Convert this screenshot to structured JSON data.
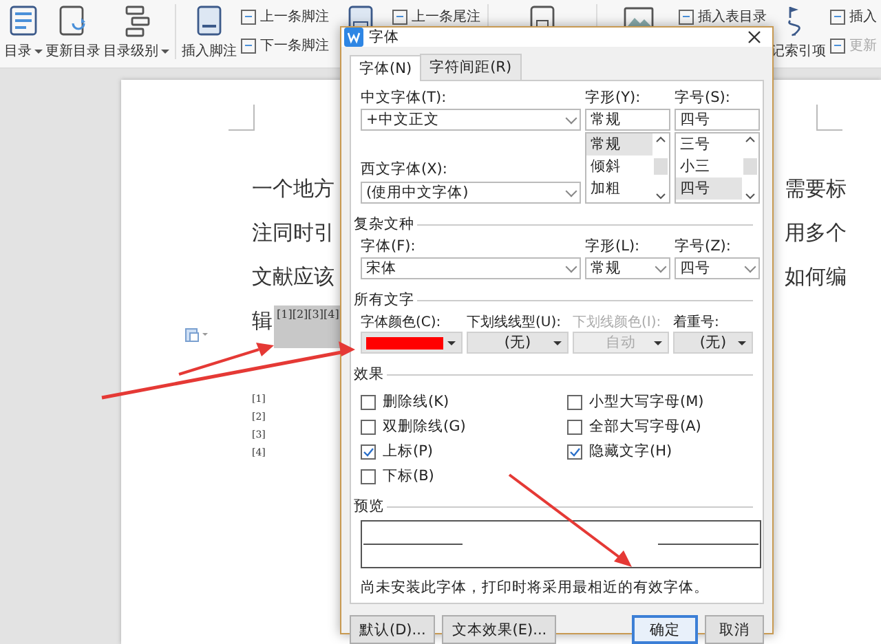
{
  "toolbar": {
    "groups": [
      {
        "kind": "large",
        "label": "目录",
        "dropdown": true
      },
      {
        "kind": "large",
        "label": "更新目录",
        "dropdown": false
      },
      {
        "kind": "large",
        "label": "目录级别",
        "dropdown": true
      },
      {
        "kind": "separator"
      },
      {
        "kind": "large",
        "label": "插入脚注",
        "dropdown": false
      },
      {
        "kind": "stack",
        "items": [
          "上一条脚注",
          "下一条脚注"
        ]
      },
      {
        "kind": "large"
      },
      {
        "kind": "stack",
        "items": [
          "上一条尾注"
        ]
      },
      {
        "kind": "separator"
      },
      {
        "kind": "large"
      },
      {
        "kind": "separator"
      },
      {
        "kind": "large"
      },
      {
        "kind": "stack",
        "items": [
          "插入表目录"
        ]
      },
      {
        "kind": "large",
        "label": "记索引项",
        "dropdown": false
      },
      {
        "kind": "stack",
        "items": [
          "插入",
          "更新"
        ]
      }
    ]
  },
  "document": {
    "lines": [
      {
        "left": "一个地方",
        "right": "需要标"
      },
      {
        "left": "注同时引",
        "right": "用多个"
      },
      {
        "left": "文献应该",
        "right": "如何编"
      },
      {
        "left": "辑",
        "superscript": "[1][2][3][4]"
      }
    ],
    "footnotes": [
      "[1]",
      "[2]",
      "[3]",
      "[4]"
    ]
  },
  "dialog": {
    "title": "字体",
    "tabs": [
      {
        "label": "字体(N)",
        "selected": true
      },
      {
        "label": "字符间距(R)",
        "selected": false
      }
    ],
    "chinese_font": {
      "label": "中文字体(T):",
      "value": "+中文正文"
    },
    "style": {
      "label": "字形(Y):",
      "value": "常规",
      "options": [
        {
          "label": "常规",
          "selected": true
        },
        {
          "label": "倾斜",
          "selected": false
        },
        {
          "label": "加粗",
          "selected": false
        }
      ]
    },
    "size": {
      "label": "字号(S):",
      "value": "四号",
      "options": [
        {
          "label": "三号",
          "selected": false
        },
        {
          "label": "小三",
          "selected": false
        },
        {
          "label": "四号",
          "selected": true
        }
      ]
    },
    "western_font": {
      "label": "西文字体(X):",
      "value": "(使用中文字体)"
    },
    "complex_section": "复杂文种",
    "complex_fields": [
      {
        "label": "字体(F):",
        "value": "宋体"
      },
      {
        "label": "字形(L):",
        "value": "常规"
      },
      {
        "label": "字号(Z):",
        "value": "四号"
      }
    ],
    "all_text_section": "所有文字",
    "all_text_fields": [
      {
        "kind": "color",
        "label": "字体颜色(C):",
        "color": "#ff0000"
      },
      {
        "kind": "select",
        "label": "下划线线型(U):",
        "value": "(无)",
        "disabled": false
      },
      {
        "kind": "select",
        "label": "下划线颜色(I):",
        "value": "自动",
        "disabled": true
      },
      {
        "kind": "select",
        "label": "着重号:",
        "value": "(无)",
        "disabled": false
      }
    ],
    "effects_section": "效果",
    "effects_left": [
      {
        "label": "删除线(K)",
        "checked": false
      },
      {
        "label": "双删除线(G)",
        "checked": false
      },
      {
        "label": "上标(P)",
        "checked": true
      },
      {
        "label": "下标(B)",
        "checked": false
      }
    ],
    "effects_right": [
      {
        "label": "小型大写字母(M)",
        "checked": false
      },
      {
        "label": "全部大写字母(A)",
        "checked": false
      },
      {
        "label": "隐藏文字(H)",
        "checked": true
      }
    ],
    "preview_section": "预览",
    "note": "尚未安装此字体，打印时将采用最相近的有效字体。",
    "buttons": [
      {
        "label": "默认(D)...",
        "default": false
      },
      {
        "label": "文本效果(E)...",
        "default": false
      },
      {
        "label": "确定",
        "default": true
      },
      {
        "label": "取消",
        "default": false
      }
    ]
  }
}
